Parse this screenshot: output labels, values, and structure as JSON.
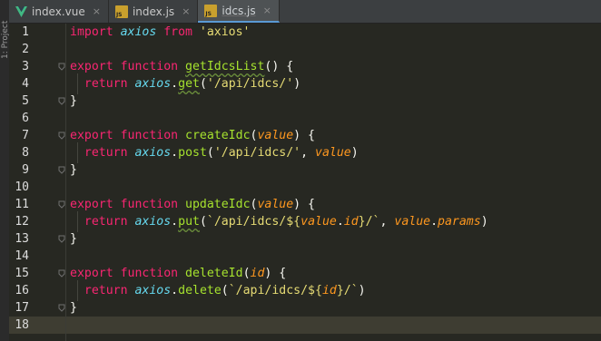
{
  "sidebar": {
    "label": "1: Project"
  },
  "tabs": [
    {
      "label": "index.vue",
      "icon": "vue-icon",
      "close": "×",
      "active": false
    },
    {
      "label": "index.js",
      "icon": "js-file-icon",
      "close": "×",
      "active": false
    },
    {
      "label": "idcs.js",
      "icon": "js-file-icon",
      "close": "×",
      "active": true
    }
  ],
  "icon_badge": "JS",
  "colors": {
    "background": "#272822",
    "keyword": "#f92672",
    "function": "#a6e22e",
    "object": "#66d9ef",
    "string": "#e6db74",
    "parameter": "#fd971f",
    "text": "#f8f8f2"
  },
  "editor": {
    "current_line": 18,
    "lines": [
      {
        "n": "1",
        "tokens": [
          [
            "kw",
            "import "
          ],
          [
            "obj",
            "axios"
          ],
          [
            "kw",
            " from "
          ],
          [
            "str",
            "'axios'"
          ]
        ]
      },
      {
        "n": "2",
        "tokens": []
      },
      {
        "n": "3",
        "fold": true,
        "tokens": [
          [
            "kw",
            "export function "
          ],
          [
            "fn",
            "getIdcsList"
          ],
          [
            "plain",
            "() {"
          ]
        ]
      },
      {
        "n": "4",
        "tokens": [
          [
            "plain",
            "  "
          ],
          [
            "kw",
            "return "
          ],
          [
            "obj",
            "axios"
          ],
          [
            "plain",
            "."
          ],
          [
            "fn",
            "get"
          ],
          [
            "plain",
            "("
          ],
          [
            "str",
            "'/api/idcs/'"
          ],
          [
            "plain",
            ")"
          ]
        ]
      },
      {
        "n": "5",
        "fold": true,
        "tokens": [
          [
            "plain",
            "}"
          ]
        ]
      },
      {
        "n": "6",
        "tokens": []
      },
      {
        "n": "7",
        "fold": true,
        "tokens": [
          [
            "kw",
            "export function "
          ],
          [
            "fn",
            "createIdc"
          ],
          [
            "plain",
            "("
          ],
          [
            "param",
            "value"
          ],
          [
            "plain",
            ") {"
          ]
        ]
      },
      {
        "n": "8",
        "tokens": [
          [
            "plain",
            "  "
          ],
          [
            "kw",
            "return "
          ],
          [
            "obj",
            "axios"
          ],
          [
            "plain",
            "."
          ],
          [
            "fn",
            "post"
          ],
          [
            "plain",
            "("
          ],
          [
            "str",
            "'/api/idcs/'"
          ],
          [
            "plain",
            ", "
          ],
          [
            "param",
            "value"
          ],
          [
            "plain",
            ")"
          ]
        ]
      },
      {
        "n": "9",
        "fold": true,
        "tokens": [
          [
            "plain",
            "}"
          ]
        ]
      },
      {
        "n": "10",
        "tokens": []
      },
      {
        "n": "11",
        "fold": true,
        "tokens": [
          [
            "kw",
            "export function "
          ],
          [
            "fn",
            "updateIdc"
          ],
          [
            "plain",
            "("
          ],
          [
            "param",
            "value"
          ],
          [
            "plain",
            ") {"
          ]
        ]
      },
      {
        "n": "12",
        "tokens": [
          [
            "plain",
            "  "
          ],
          [
            "kw",
            "return "
          ],
          [
            "obj",
            "axios"
          ],
          [
            "plain",
            "."
          ],
          [
            "fn",
            "put"
          ],
          [
            "plain",
            "("
          ],
          [
            "str",
            "`/api/idcs/${"
          ],
          [
            "param",
            "value"
          ],
          [
            "plain",
            "."
          ],
          [
            "param",
            "id"
          ],
          [
            "str",
            "}/`"
          ],
          [
            "plain",
            ", "
          ],
          [
            "param",
            "value"
          ],
          [
            "plain",
            "."
          ],
          [
            "param",
            "params"
          ],
          [
            "plain",
            ")"
          ]
        ]
      },
      {
        "n": "13",
        "fold": true,
        "tokens": [
          [
            "plain",
            "}"
          ]
        ]
      },
      {
        "n": "14",
        "tokens": []
      },
      {
        "n": "15",
        "fold": true,
        "tokens": [
          [
            "kw",
            "export function "
          ],
          [
            "fn",
            "deleteId"
          ],
          [
            "plain",
            "("
          ],
          [
            "param",
            "id"
          ],
          [
            "plain",
            ") {"
          ]
        ]
      },
      {
        "n": "16",
        "tokens": [
          [
            "plain",
            "  "
          ],
          [
            "kw",
            "return "
          ],
          [
            "obj",
            "axios"
          ],
          [
            "plain",
            "."
          ],
          [
            "fn",
            "delete"
          ],
          [
            "plain",
            "("
          ],
          [
            "str",
            "`/api/idcs/${"
          ],
          [
            "param",
            "id"
          ],
          [
            "str",
            "}/`"
          ],
          [
            "plain",
            ")"
          ]
        ]
      },
      {
        "n": "17",
        "fold": true,
        "tokens": [
          [
            "plain",
            "}"
          ]
        ]
      },
      {
        "n": "18",
        "tokens": []
      }
    ]
  }
}
